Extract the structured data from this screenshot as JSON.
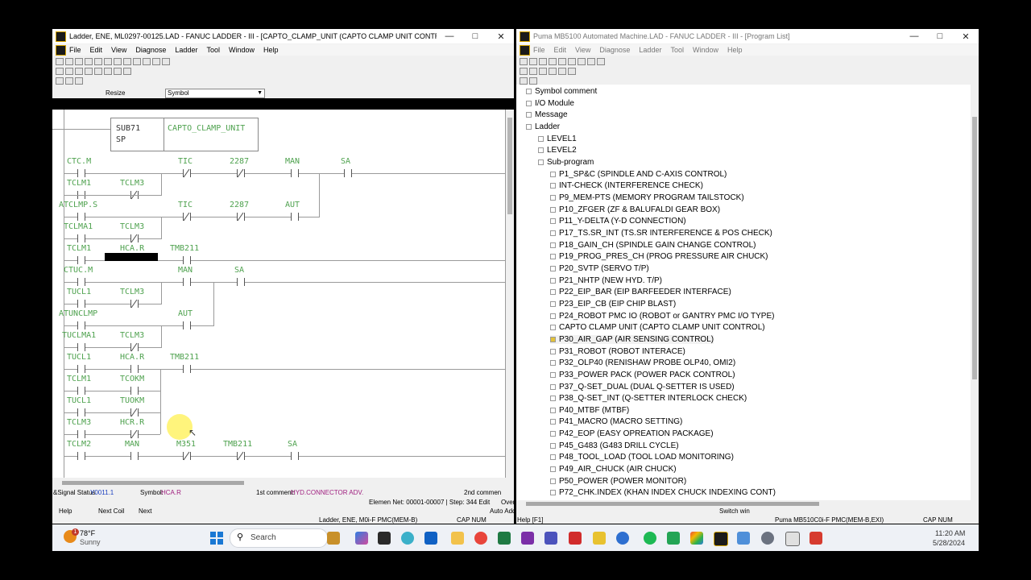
{
  "left_window": {
    "title": "Ladder, ENE, ML0297-00125.LAD - FANUC LADDER - III - [CAPTO_CLAMP_UNIT (CAPTO CLAMP UNIT CONTROL)]",
    "menu": [
      "File",
      "Edit",
      "View",
      "Diagnose",
      "Ladder",
      "Tool",
      "Window",
      "Help"
    ],
    "toolbar_resize": "Resize",
    "toolbar_symbol": "Symbol",
    "sub_label": "SUB71",
    "sub_sp": "SP",
    "sub_name": "CAPTO_CLAMP_UNIT",
    "signal_status_label": "&Signal Status",
    "signal_status_value": "Y0011.1",
    "symbol_label": "Symbol:",
    "symbol_value": "HCA.R",
    "first_comment_label": "1st comment:",
    "first_comment_value": "HYD.CONNECTOR ADV.",
    "second_comment_label": "2nd commen",
    "element_info": "Elemen Net: 00001-00007 | Step: 344 Edit",
    "over": "Over",
    "auto_add": "Auto Add",
    "fkeys": [
      "Help",
      "Next Coil",
      "Next"
    ],
    "status_bar": "Ladder, ENE, M0i-F PMC(MEM-B)",
    "cap_num": "CAP NUM",
    "ladder_labels": {
      "r1": [
        "CTC.M",
        "TIC",
        "2287",
        "MAN",
        "SA"
      ],
      "r2": [
        "TCLM1",
        "TCLM3"
      ],
      "r3": [
        "ATCLMP.S",
        "TIC",
        "2287",
        "AUT"
      ],
      "r4": [
        "TCLMA1",
        "TCLM3"
      ],
      "r5": [
        "TCLM1",
        "HCA.R",
        "TMB211"
      ],
      "r6": [
        "CTUC.M",
        "MAN",
        "SA"
      ],
      "r7": [
        "TUCL1",
        "TCLM3"
      ],
      "r8": [
        "ATUNCLMP",
        "AUT"
      ],
      "r9": [
        "TUCLMA1",
        "TCLM3"
      ],
      "r10": [
        "TUCL1",
        "HCA.R",
        "TMB211"
      ],
      "r11": [
        "TCLM1",
        "TCOKM"
      ],
      "r12": [
        "TUCL1",
        "TUOKM"
      ],
      "r13": [
        "TCLM3",
        "HCR.R"
      ],
      "r14": [
        "TCLM2",
        "MAN",
        "M351",
        "TMB211",
        "SA"
      ]
    }
  },
  "right_window": {
    "title": "Puma MB5100 Automated Machine.LAD - FANUC LADDER - III - [Program List]",
    "menu": [
      "File",
      "Edit",
      "View",
      "Diagnose",
      "Ladder",
      "Tool",
      "Window",
      "Help"
    ],
    "tree": [
      "Symbol comment",
      "I/O Module",
      "Message",
      "Ladder",
      "LEVEL1",
      "LEVEL2",
      "Sub-program",
      "P1_SP&C (SPINDLE AND C-AXIS CONTROL)",
      "INT-CHECK (INTERFERENCE CHECK)",
      "P9_MEM-PTS (MEMORY PROGRAM TAILSTOCK)",
      "P10_ZFGER (ZF & BALUFALDI GEAR BOX)",
      "P11_Y-DELTA (Y-D CONNECTION)",
      "P17_TS.SR_INT (TS.SR INTERFERENCE & POS CHECK)",
      "P18_GAIN_CH (SPINDLE GAIN CHANGE CONTROL)",
      "P19_PROG_PRES_CH (PROG PRESSURE AIR CHUCK)",
      "P20_SVTP (SERVO T/P)",
      "P21_NHTP (NEW HYD. T/P)",
      "P22_EIP_BAR (EIP BARFEEDER INTERFACE)",
      "P23_EIP_CB (EIP CHIP BLAST)",
      "P24_ROBOT PMC IO (ROBOT or GANTRY PMC I/O TYPE)",
      "CAPTO CLAMP UNIT (CAPTO CLAMP UNIT CONTROL)",
      "P30_AIR_GAP (AIR SENSING CONTROL)",
      "P31_ROBOT (ROBOT INTERACE)",
      "P32_OLP40 (RENISHAW PROBE OLP40, OMI2)",
      "P33_POWER PACK (POWER PACK CONTROL)",
      "P37_Q-SET_DUAL (DUAL Q-SETTER IS USED)",
      "P38_Q-SET_INT (Q-SETTER INTERLOCK CHECK)",
      "P40_MTBF (MTBF)",
      "P41_MACRO (MACRO SETTING)",
      "P42_EOP (EASY OPREATION PACKAGE)",
      "P45_G483 (G483 DRILL CYCLE)",
      "P48_TOOL_LOAD (TOOL LOAD MONITORING)",
      "P49_AIR_CHUCK (AIR CHUCK)",
      "P50_POWER (POWER MONITOR)",
      "P72_CHK.INDEX (KHAN INDEX CHUCK INDEXING CONT)"
    ],
    "fkey_switch": "Switch win",
    "help_hint": "Help [F1]",
    "status_bar": "Puma MB510C0i-F PMC(MEM-B,EXI)",
    "cap_num": "CAP NUM"
  },
  "taskbar": {
    "weather_temp": "78°F",
    "weather_desc": "Sunny",
    "weather_badge": "1",
    "search_label": "Search",
    "time": "11:20 AM",
    "date": "5/28/2024"
  }
}
